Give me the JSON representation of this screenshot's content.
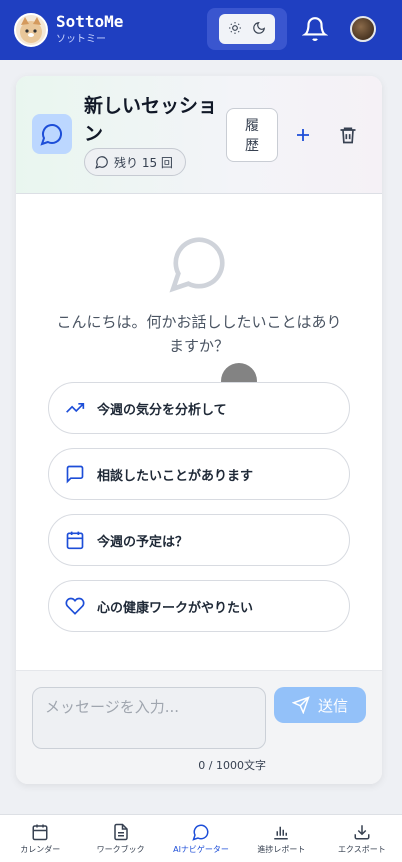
{
  "header": {
    "app_name": "SottoMe",
    "app_sub": "ソットミー",
    "icons": {
      "light": "sun-icon",
      "dark": "moon-icon",
      "bell": "bell-icon",
      "avatar": "user-avatar"
    }
  },
  "session": {
    "title": "新しいセッション",
    "remaining_label": "残り 15 回",
    "history_line1": "履",
    "history_line2": "歴"
  },
  "chat": {
    "greeting": "こんにちは。何かお話ししたいことはありますか？",
    "suggestions": [
      {
        "icon": "trending-up-icon",
        "label": "今週の気分を分析して"
      },
      {
        "icon": "message-square-icon",
        "label": "相談したいことがあります"
      },
      {
        "icon": "calendar-icon",
        "label": "今週の予定は？"
      },
      {
        "icon": "heart-icon",
        "label": "心の健康ワークがやりたい"
      }
    ]
  },
  "composer": {
    "placeholder": "メッセージを入力...",
    "value": "",
    "send_label": "送信",
    "counter": "0 / 1000文字"
  },
  "nav": {
    "items": [
      {
        "icon": "calendar-icon",
        "label": "カレンダー"
      },
      {
        "icon": "file-text-icon",
        "label": "ワークブック"
      },
      {
        "icon": "message-circle-icon",
        "label": "AIナビゲーター"
      },
      {
        "icon": "bar-chart-icon",
        "label": "進捗レポート"
      },
      {
        "icon": "download-icon",
        "label": "エクスポート"
      }
    ]
  },
  "colors": {
    "header_bg": "#1f3fc1",
    "accent": "#1d4ed8",
    "send_bg": "#93c1f9"
  }
}
